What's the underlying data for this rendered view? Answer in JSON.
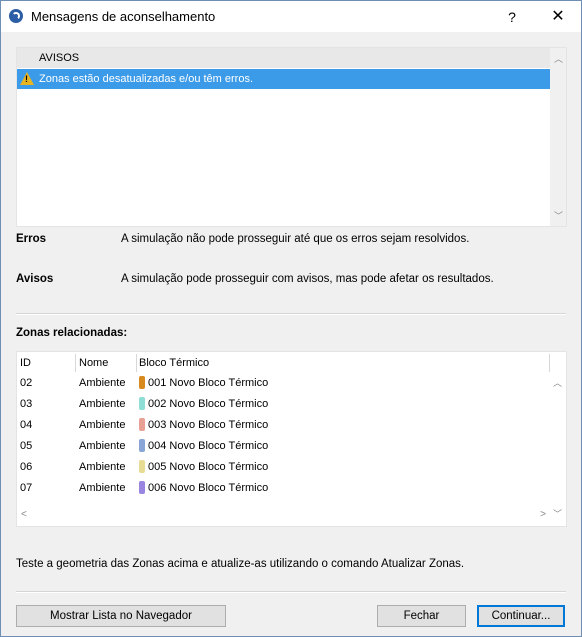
{
  "window": {
    "title": "Mensagens de aconselhamento",
    "help_label": "?",
    "close_label": "✕"
  },
  "messages": {
    "header": "AVISOS",
    "items": [
      {
        "text": "Zonas estão desatualizadas e/ou têm erros.",
        "icon": "warning-icon"
      }
    ]
  },
  "legend": {
    "errors_label": "Erros",
    "errors_desc": "A simulação não pode prosseguir até que os erros sejam resolvidos.",
    "warnings_label": "Avisos",
    "warnings_desc": "A simulação pode prosseguir com avisos, mas pode afetar os resultados."
  },
  "zones": {
    "title": "Zonas relacionadas:",
    "columns": [
      "ID",
      "Nome",
      "Bloco Térmico"
    ],
    "rows": [
      {
        "id": "02",
        "name": "Ambiente",
        "block": "001 Novo Bloco Térmico",
        "color": "#d98a1f"
      },
      {
        "id": "03",
        "name": "Ambiente",
        "block": "002 Novo Bloco Térmico",
        "color": "#8fded6"
      },
      {
        "id": "04",
        "name": "Ambiente",
        "block": "003 Novo Bloco Térmico",
        "color": "#e8a094"
      },
      {
        "id": "05",
        "name": "Ambiente",
        "block": "004 Novo Bloco Térmico",
        "color": "#8aa6d8"
      },
      {
        "id": "06",
        "name": "Ambiente",
        "block": "005 Novo Bloco Térmico",
        "color": "#e8db94"
      },
      {
        "id": "07",
        "name": "Ambiente",
        "block": "006 Novo Bloco Térmico",
        "color": "#9a86e0"
      }
    ]
  },
  "footer": {
    "instruction": "Teste a geometria das Zonas acima e atualize-as utilizando o comando Atualizar Zonas."
  },
  "buttons": {
    "show_list": "Mostrar Lista no Navegador",
    "close": "Fechar",
    "continue": "Continuar..."
  }
}
